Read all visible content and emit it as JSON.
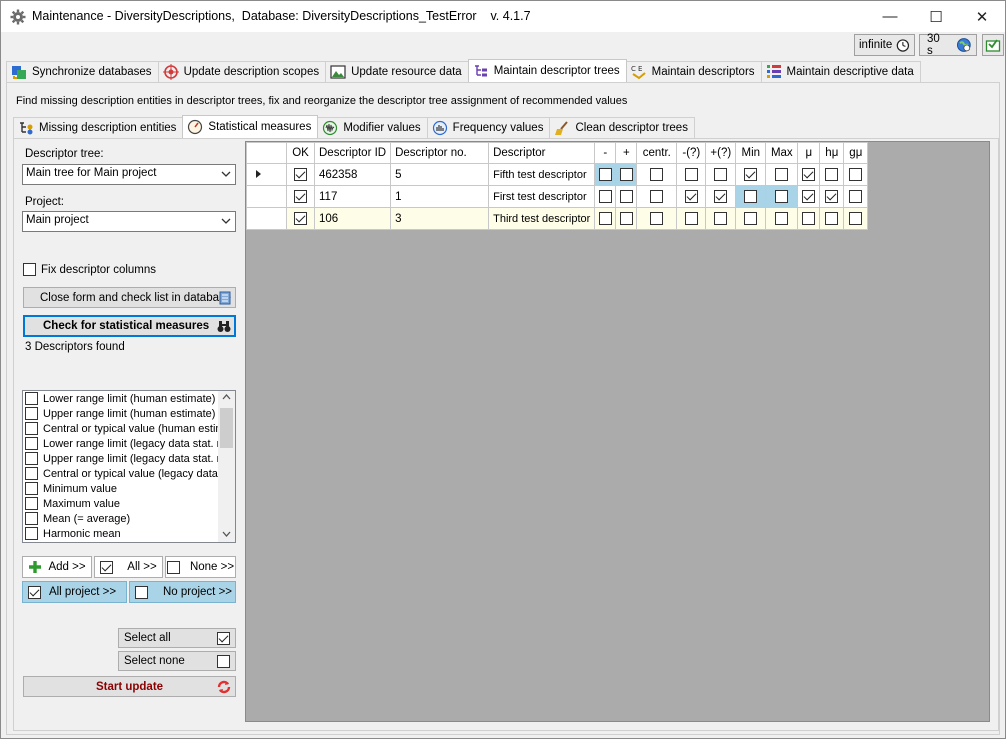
{
  "window": {
    "title": "Maintenance - DiversityDescriptions,  Database: DiversityDescriptions_TestError    v. 4.1.7",
    "minimize": "—",
    "maximize": "☐",
    "close": "✕"
  },
  "topstrip": {
    "timeout_label": "infinite",
    "interval_label": "30 s"
  },
  "main_tabs": [
    {
      "label": "Synchronize databases",
      "icon": "sync-icon"
    },
    {
      "label": "Update description scopes",
      "icon": "target-icon"
    },
    {
      "label": "Update resource data",
      "icon": "image-icon"
    },
    {
      "label": "Maintain descriptor trees",
      "icon": "tree-icon",
      "active": true
    },
    {
      "label": "Maintain descriptors",
      "icon": "descriptor-icon"
    },
    {
      "label": "Maintain descriptive data",
      "icon": "data-icon"
    }
  ],
  "info_text": "Find missing description entities in descriptor trees, fix and reorganize the descriptor tree assignment of recommended values",
  "sub_tabs": [
    {
      "label": "Missing description entities",
      "icon": "missing-icon"
    },
    {
      "label": "Statistical measures",
      "icon": "gauge-icon",
      "active": true
    },
    {
      "label": "Modifier values",
      "icon": "modifier-icon"
    },
    {
      "label": "Frequency values",
      "icon": "frequency-icon"
    },
    {
      "label": "Clean descriptor trees",
      "icon": "broom-icon"
    }
  ],
  "left": {
    "descriptor_tree_label": "Descriptor tree:",
    "descriptor_tree_value": "Main tree for Main project",
    "project_label": "Project:",
    "project_value": "Main project",
    "fix_columns_label": "Fix descriptor columns",
    "close_button": "Close form and check list in database",
    "check_button": "Check for statistical measures",
    "found_text": "3 Descriptors found",
    "measures": [
      "Lower range limit (human estimate)",
      "Upper range limit (human estimate)",
      "Central or typical value (human estima",
      "Lower range limit (legacy data stat. m",
      "Upper range limit (legacy data stat. m",
      "Central or typical value (legacy data s",
      "Minimum value",
      "Maximum value",
      "Mean (= average)",
      "Harmonic mean"
    ],
    "add_button": "Add >>",
    "all_button": "All >>",
    "none_button": "None >>",
    "all_project_button": "All project >>",
    "no_project_button": "No project >>",
    "select_all_label": "Select all",
    "select_none_label": "Select none",
    "start_update_button": "Start update"
  },
  "grid": {
    "columns": [
      "OK",
      "Descriptor ID",
      "Descriptor no.",
      "Descriptor",
      "-",
      "+",
      "centr.",
      "-(?)",
      "+(?)",
      "Min",
      "Max",
      "μ",
      "hμ",
      "gμ"
    ],
    "rows": [
      {
        "ok": true,
        "id": "462358",
        "no": "5",
        "name": "Fifth test descriptor",
        "flags": [
          false,
          false,
          false,
          false,
          false,
          true,
          false,
          true,
          false,
          false
        ]
      },
      {
        "ok": true,
        "id": "117",
        "no": "1",
        "name": "First test descriptor",
        "flags": [
          false,
          false,
          false,
          true,
          true,
          false,
          false,
          true,
          true,
          false
        ]
      },
      {
        "ok": true,
        "id": "106",
        "no": "3",
        "name": "Third test descriptor",
        "flags": [
          false,
          false,
          false,
          false,
          false,
          false,
          false,
          false,
          false,
          false
        ]
      }
    ]
  }
}
